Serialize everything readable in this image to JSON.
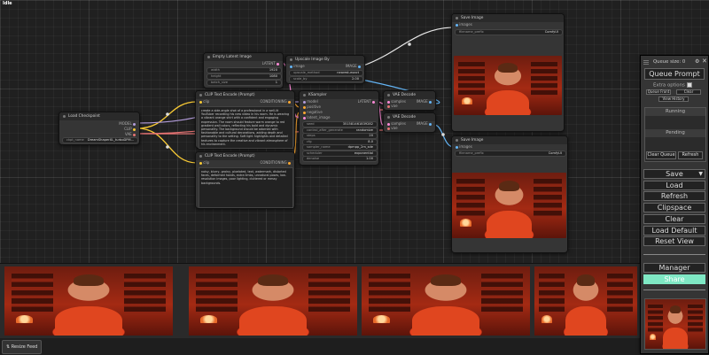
{
  "app": {
    "title": "Idle"
  },
  "nodes": {
    "load_checkpoint": {
      "title": "Load Checkpoint",
      "outputs": [
        "MODEL",
        "CLIP",
        "VAE"
      ],
      "widget": {
        "label": "ckpt_name",
        "value": "DreamShaperXL_turboDPM..."
      }
    },
    "empty_latent": {
      "title": "Empty Latent Image",
      "output": "LATENT",
      "widgets": [
        {
          "label": "width",
          "value": "1920"
        },
        {
          "label": "height",
          "value": "1080"
        },
        {
          "label": "batch_size",
          "value": "1"
        }
      ]
    },
    "upscale": {
      "title": "Upscale Image By",
      "input": "image",
      "output": "IMAGE",
      "widgets": [
        {
          "label": "upscale_method",
          "value": "nearest-exact"
        },
        {
          "label": "scale_by",
          "value": "2.00"
        }
      ]
    },
    "clip_pos": {
      "title": "CLIP Text Encode (Prompt)",
      "input": "clip",
      "output": "CONDITIONING",
      "text": "create a side-angle shot of a professional in a well-lit YouTuber recording his new video in his room. He is wearing a vibrant orange shirt with a confident and engaging expression. The room should feature warm orange to red gradient wall colors, reflecting his bold and dynamic personality. The background should be adorned with fashionable and cultural decorations, adding depth and personality to the setting. Soft light highlights and detailed textures to capture the creative and vibrant atmosphere of his environment."
    },
    "clip_neg": {
      "title": "CLIP Text Encode (Prompt)",
      "input": "clip",
      "output": "CONDITIONING",
      "text": "noisy, blurry, grainy, pixelated, text, watermark, distorted faces, deformed hands, extra limbs, unnatural poses, low-resolution images, poor lighting, cluttered or messy backgrounds."
    },
    "ksampler": {
      "title": "KSampler",
      "inputs": [
        "model",
        "positive",
        "negative",
        "latent_image"
      ],
      "output": "LATENT",
      "widgets": [
        {
          "label": "seed",
          "value": "351581461839282"
        },
        {
          "label": "control_after_generate",
          "value": "randomize"
        },
        {
          "label": "steps",
          "value": "20"
        },
        {
          "label": "cfg",
          "value": "8.0"
        },
        {
          "label": "sampler_name",
          "value": "dpmpp_2m_sde"
        },
        {
          "label": "scheduler",
          "value": "exponential"
        },
        {
          "label": "denoise",
          "value": "1.00"
        }
      ]
    },
    "vae_decode_1": {
      "title": "VAE Decode",
      "inputs": [
        "samples",
        "vae"
      ],
      "output": "IMAGE"
    },
    "vae_decode_2": {
      "title": "VAE Decode",
      "inputs": [
        "samples",
        "vae"
      ],
      "output": "IMAGE"
    },
    "save_image": {
      "title": "Save Image",
      "input": "images",
      "widget": {
        "label": "filename_prefix",
        "value": "ComfyUI"
      }
    },
    "save_image_2": {
      "title": "Save Image",
      "input": "images",
      "widget": {
        "label": "filename_prefix",
        "value": "ComfyUI"
      }
    }
  },
  "feed": {
    "resize_label": "Resize Feed",
    "image_count": 4
  },
  "menu": {
    "queue_size_label": "Queue size: 0",
    "queue_prompt": "Queue Prompt",
    "extra_options": "Extra options",
    "small_buttons": [
      "Queue Front",
      "Clear",
      "View History"
    ],
    "running": "Running",
    "pending": "Pending",
    "clear_queue": "Clear Queue",
    "refresh_small": "Refresh",
    "save": "Save",
    "load": "Load",
    "refresh": "Refresh",
    "clipspace": "Clipspace",
    "clear": "Clear",
    "load_default": "Load Default",
    "reset_view": "Reset View",
    "manager": "Manager",
    "share": "Share"
  },
  "colors": {
    "wire_clip": "#f7c935",
    "wire_model": "#b39ddb",
    "wire_vae": "#e57373",
    "wire_latent": "#ff8ad8",
    "wire_image": "#64b5f6",
    "wire_cond": "#ffa931",
    "share": "#7fe8c4"
  }
}
